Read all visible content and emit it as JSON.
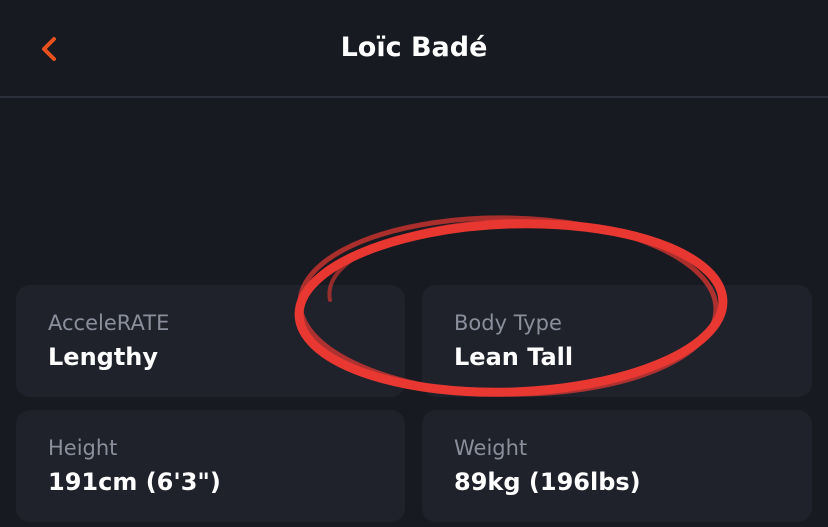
{
  "header": {
    "title": "Loïc Badé",
    "back_icon": "chevron-left-icon",
    "accent_color": "#e8501e"
  },
  "stats": [
    {
      "label": "AcceleRATE",
      "value": "Lengthy"
    },
    {
      "label": "Body Type",
      "value": "Lean Tall"
    },
    {
      "label": "Height",
      "value": "191cm (6'3\")"
    },
    {
      "label": "Weight",
      "value": "89kg (196lbs)"
    }
  ],
  "annotation": {
    "shape": "hand-drawn-ellipse",
    "color": "#ff3b33"
  }
}
